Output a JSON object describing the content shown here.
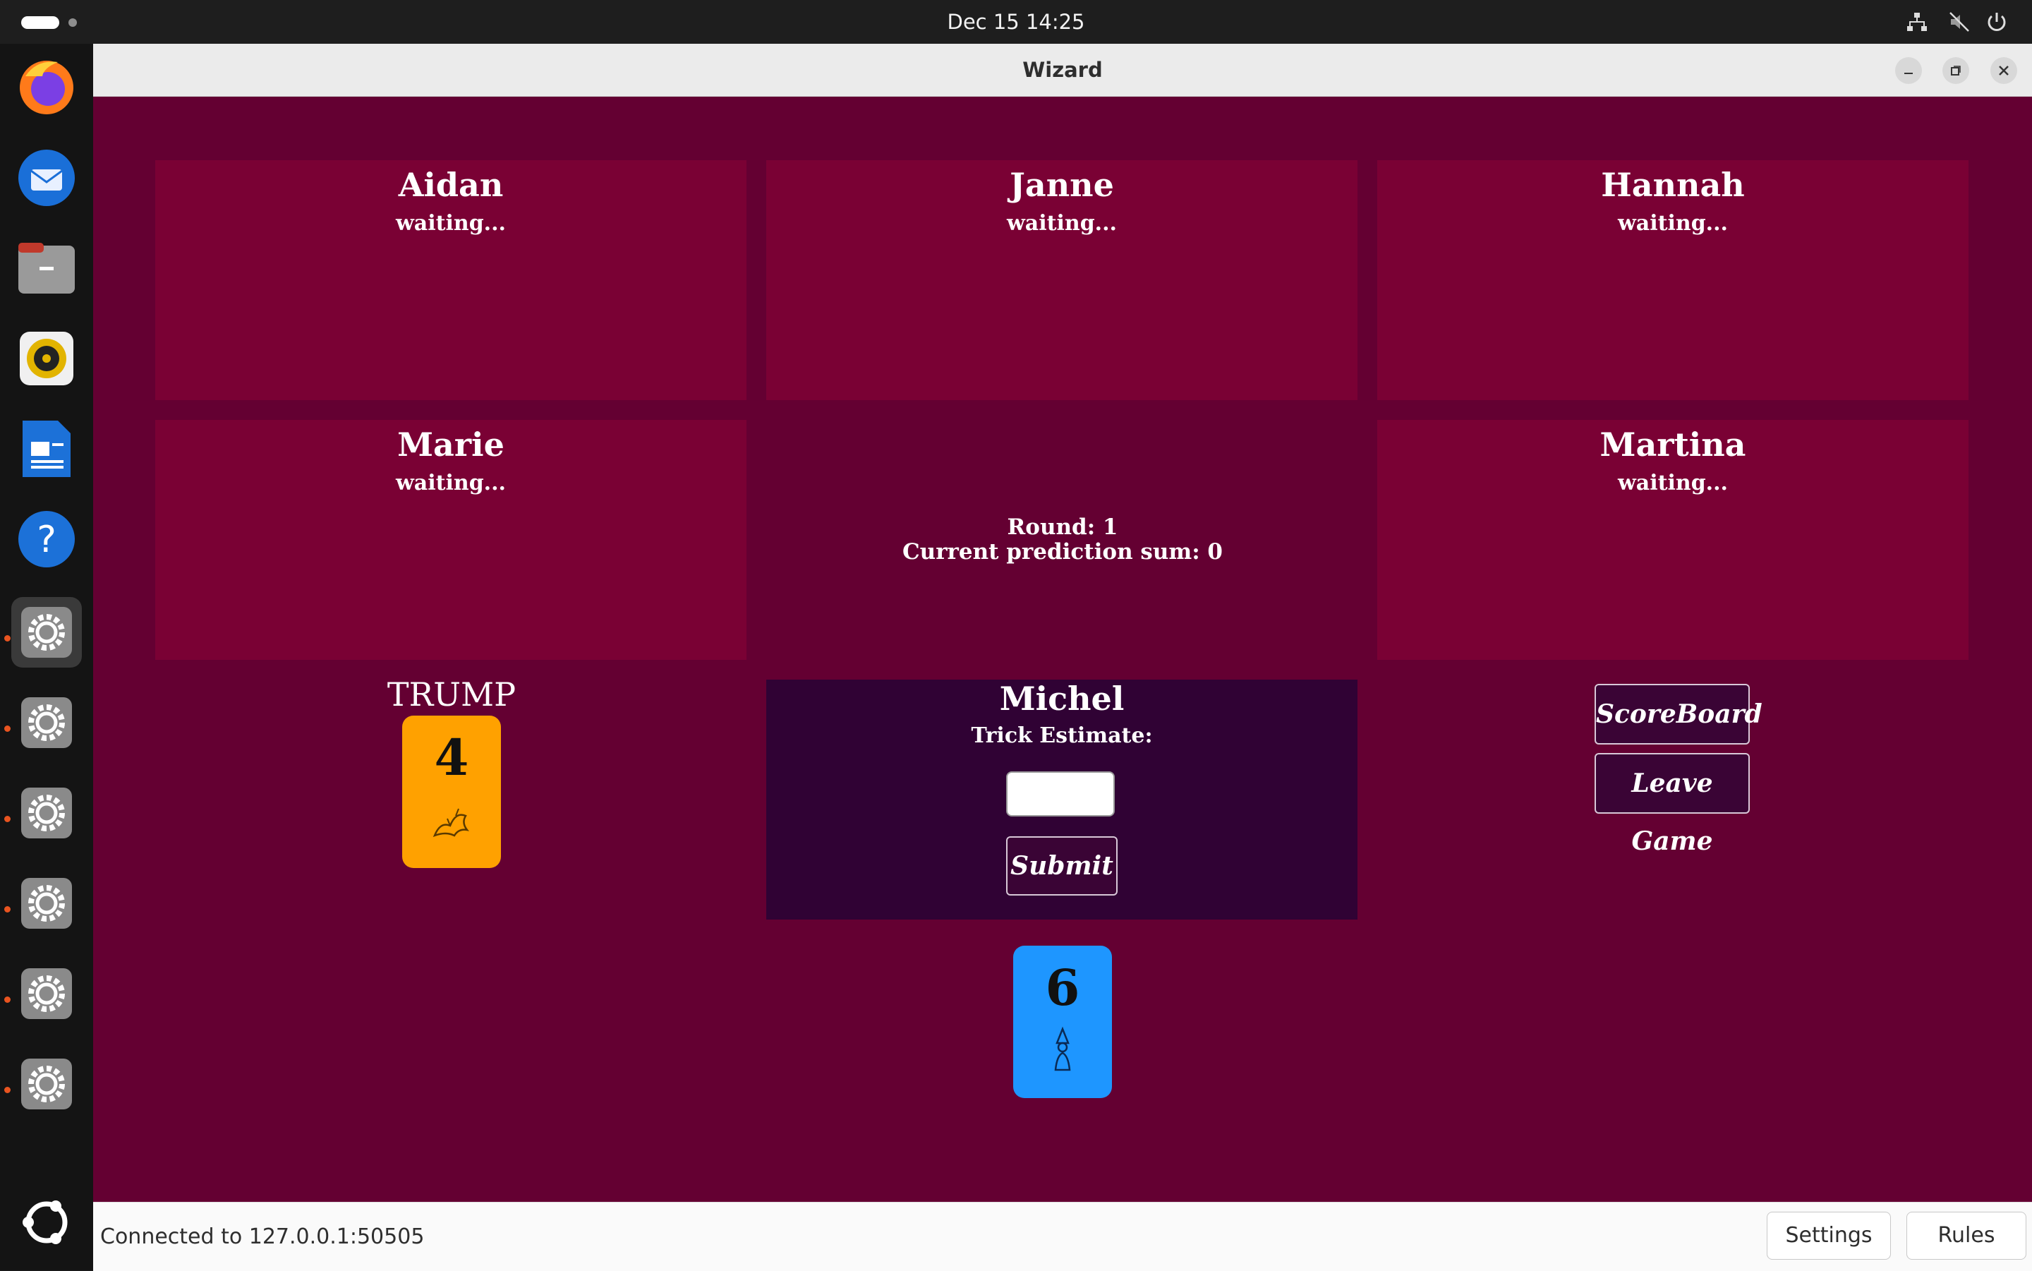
{
  "system": {
    "clock": "Dec 15  14:25"
  },
  "window": {
    "title": "Wizard"
  },
  "players": [
    {
      "name": "Aidan",
      "status": "waiting..."
    },
    {
      "name": "Janne",
      "status": "waiting..."
    },
    {
      "name": "Hannah",
      "status": "waiting..."
    },
    {
      "name": "Marie",
      "status": "waiting..."
    },
    {
      "name": "Martina",
      "status": "waiting..."
    }
  ],
  "round_info": {
    "round": "Round: 1",
    "prediction_sum": "Current prediction sum: 0"
  },
  "trump": {
    "label": "TRUMP",
    "card_value": "4",
    "card_color": "#ffa100"
  },
  "me": {
    "name": "Michel",
    "estimate_label": "Trick Estimate:",
    "estimate_value": "",
    "submit_label": "Submit"
  },
  "hand": [
    {
      "value": "6",
      "color": "#1e96ff"
    }
  ],
  "actions": {
    "scoreboard_label": "ScoreBoard",
    "leave_label": "Leave Game"
  },
  "status": {
    "connection": "Connected to 127.0.0.1:50505",
    "settings_label": "Settings",
    "rules_label": "Rules"
  },
  "dock": [
    "firefox-icon",
    "thunderbird-icon",
    "files-icon",
    "rhythmbox-icon",
    "writer-icon",
    "help-icon",
    "settings-icon",
    "settings-icon",
    "settings-icon",
    "settings-icon",
    "settings-icon",
    "settings-icon",
    "ubuntu-icon"
  ]
}
